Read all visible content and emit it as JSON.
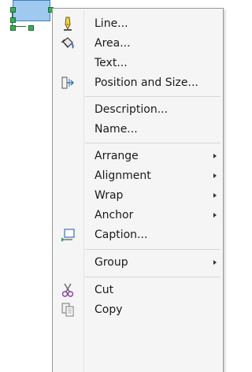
{
  "menu": {
    "items": [
      {
        "label": "Line...",
        "icon": "pen-icon"
      },
      {
        "label": "Area...",
        "icon": "paint-bucket-icon"
      },
      {
        "label": "Text...",
        "icon": ""
      },
      {
        "label": "Position and Size...",
        "icon": "position-size-icon"
      },
      {
        "label": "Description..."
      },
      {
        "label": "Name..."
      },
      {
        "label": "Arrange",
        "submenu": true
      },
      {
        "label": "Alignment",
        "submenu": true
      },
      {
        "label": "Wrap",
        "submenu": true
      },
      {
        "label": "Anchor",
        "submenu": true
      },
      {
        "label": "Caption...",
        "icon": "caption-icon"
      },
      {
        "label": "Group",
        "submenu": true
      },
      {
        "label": "Cut",
        "icon": "scissors-icon"
      },
      {
        "label": "Copy",
        "icon": "copy-icon"
      }
    ]
  },
  "colors": {
    "menu_bg": "#f5f5f5",
    "shape_fill": "#9fc9ee",
    "handle": "#38ae56"
  }
}
